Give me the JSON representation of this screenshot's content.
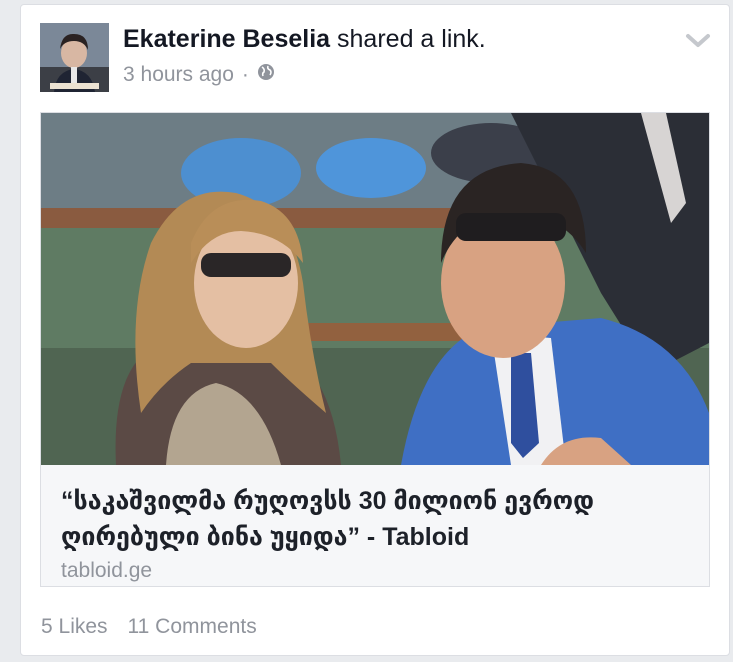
{
  "post": {
    "author": "Ekaterine Beselia",
    "action": "shared a link.",
    "time": "3 hours ago",
    "separator": "·",
    "privacy_icon": "globe-icon",
    "options_icon": "chevron-down-icon"
  },
  "link": {
    "title": "“საკაშვილმა რუღოვსს 30 მილიონ ევროდ ღირებული ბინა უყიდა” - Tabloid",
    "domain": "tabloid.ge"
  },
  "stats": {
    "likes": "5 Likes",
    "comments": "11 Comments"
  },
  "colors": {
    "name_text": "#141823",
    "meta_text": "#90949c",
    "suit_blue": "#3f6fc4"
  }
}
